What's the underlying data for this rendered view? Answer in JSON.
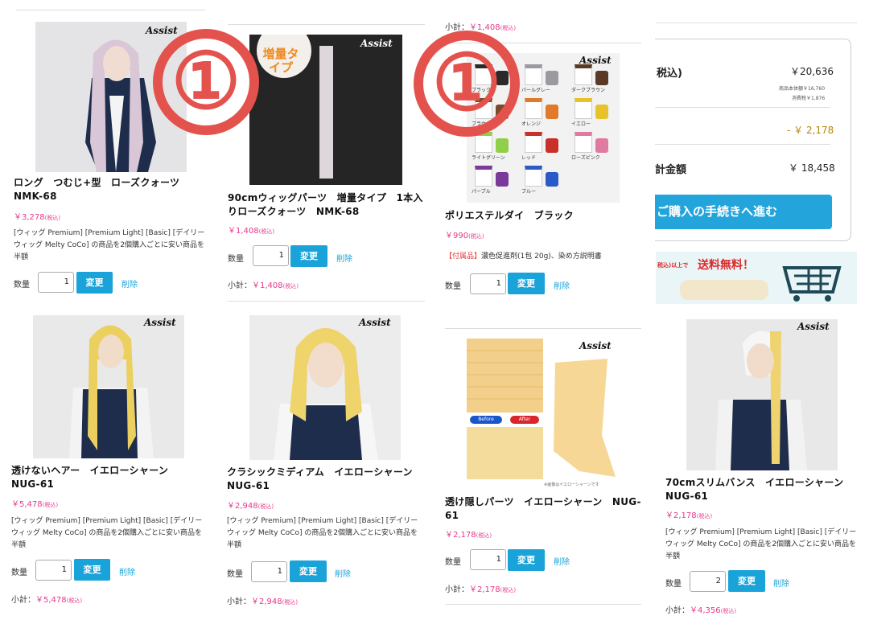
{
  "col1": {
    "item1": {
      "name": "ロング　つむじ+型　ローズクォーツ　NMK-68",
      "price": "￥3,278",
      "tax": "(税込)",
      "note": "[ウィッグ Premium] [Premium Light] [Basic] [デイリーウィッグ Melty CoCo] の商品を2個購入ごとに安い商品を半額",
      "qty_label": "数量",
      "qty": "1",
      "change": "変更",
      "delete": "削除"
    },
    "item2": {
      "name": "透けないヘアー　イエローシャーン　NUG-61",
      "price": "￥5,478",
      "tax": "(税込)",
      "note": "[ウィッグ Premium] [Premium Light] [Basic] [デイリーウィッグ Melty CoCo] の商品を2個購入ごとに安い商品を半額",
      "qty_label": "数量",
      "qty": "1",
      "change": "変更",
      "delete": "削除",
      "subtotal_label": "小計：",
      "subtotal": "￥5,478",
      "subtotal_tax": "(税込)"
    }
  },
  "col2": {
    "item1": {
      "name": "90cmウィッグパーツ　増量タイプ　1本入りローズクォーツ　NMK-68",
      "badge": "増量タイプ",
      "price": "￥1,408",
      "tax": "(税込)",
      "qty_label": "数量",
      "qty": "1",
      "change": "変更",
      "delete": "削除",
      "subtotal_label": "小計：",
      "subtotal": "￥1,408",
      "subtotal_tax": "(税込)"
    },
    "item2": {
      "name": "クラシックミディアム　イエローシャーンNUG-61",
      "price": "￥2,948",
      "tax": "(税込)",
      "note": "[ウィッグ Premium] [Premium Light] [Basic] [デイリーウィッグ Melty CoCo] の商品を2個購入ごとに安い商品を半額",
      "qty_label": "数量",
      "qty": "1",
      "change": "変更",
      "delete": "削除",
      "subtotal_label": "小計：",
      "subtotal": "￥2,948",
      "subtotal_tax": "(税込)"
    }
  },
  "col3": {
    "top_subtotal_label": "小計：",
    "top_subtotal": "￥1,408",
    "top_subtotal_tax": "(税込)",
    "item1": {
      "name": "ポリエステルダイ　ブラック",
      "price": "￥990",
      "tax": "(税込)",
      "note_tag": "【付属品】",
      "note": "濃色促進剤(1包 20g)、染め方説明書",
      "qty_label": "数量",
      "qty": "1",
      "change": "変更",
      "delete": "削除",
      "swatches": [
        "ブラック",
        "パールグレー",
        "ダークブラウン",
        "ブラウン",
        "オレンジ",
        "イエロー",
        "ライトグリーン",
        "レッド",
        "ローズピンク",
        "パープル",
        "ブルー"
      ]
    },
    "item2": {
      "name": "透け隠しパーツ　イエローシャーン　NUG-61",
      "before": "Before",
      "after": "After",
      "caption": "※画像はイエローシャーンです",
      "price": "￥2,178",
      "tax": "(税込)",
      "qty_label": "数量",
      "qty": "1",
      "change": "変更",
      "delete": "削除",
      "subtotal_label": "小計：",
      "subtotal": "￥2,178",
      "subtotal_tax": "(税込)"
    }
  },
  "col4": {
    "summary": {
      "tax_label": "税込)",
      "total": "￥20,636",
      "base_label": "商品本体額",
      "base": "￥16,760",
      "tax_amt_label": "消費税",
      "tax_amt": "￥1,876",
      "discount": "- ￥ 2,178",
      "grand_label": "計金額",
      "grand": "￥ 18,458",
      "checkout": "ご購入の手続きへ進む"
    },
    "banner": {
      "text": "送料無料！",
      "prefix": "税込)以上で"
    },
    "item1": {
      "name": "70cmスリムバンス　イエローシャーンNUG-61",
      "price": "￥2,178",
      "tax": "(税込)",
      "note": "[ウィッグ Premium] [Premium Light] [Basic] [デイリーウィッグ Melty CoCo] の商品を2個購入ごとに安い商品を半額",
      "qty_label": "数量",
      "qty": "2",
      "change": "変更",
      "delete": "削除",
      "subtotal_label": "小計：",
      "subtotal": "￥4,356",
      "subtotal_tax": "(税込)"
    }
  },
  "overlay": {
    "marker": "①",
    "logo": "Assist"
  },
  "colors": {
    "accent": "#1aa3d9",
    "price": "#e7388d",
    "marker": "#e4524d"
  }
}
